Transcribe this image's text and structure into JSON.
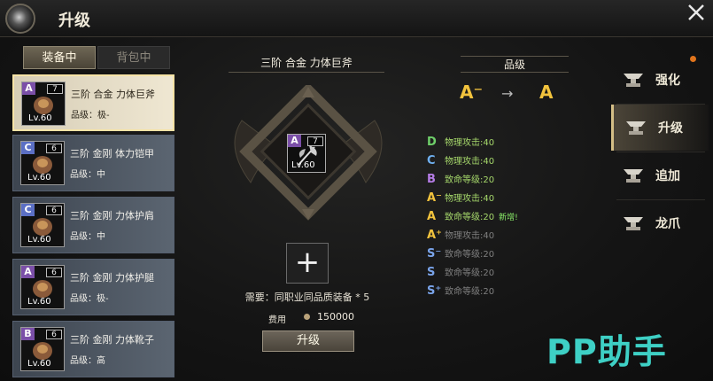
{
  "window": {
    "title": "升级"
  },
  "left_tabs": [
    {
      "label": "装备中",
      "active": true
    },
    {
      "label": "背包中",
      "active": false
    }
  ],
  "items": [
    {
      "grade": "A",
      "grade_suffix": "-",
      "grade_color": "#7b4fa8",
      "stars": "7",
      "level": "Lv.60",
      "name": "三阶 合金 力体巨斧",
      "quality": "品级：极-",
      "selected": true
    },
    {
      "grade": "C",
      "grade_suffix": "",
      "grade_color": "#5b6fc4",
      "stars": "6",
      "level": "Lv.60",
      "name": "三阶 金刚 体力铠甲",
      "quality": "品级：中",
      "selected": false
    },
    {
      "grade": "C",
      "grade_suffix": "",
      "grade_color": "#5b6fc4",
      "stars": "6",
      "level": "Lv.60",
      "name": "三阶 金刚 力体护肩",
      "quality": "品级：中",
      "selected": false
    },
    {
      "grade": "A",
      "grade_suffix": "",
      "grade_color": "#7b4fa8",
      "stars": "6",
      "level": "Lv.60",
      "name": "三阶 金刚 力体护腿",
      "quality": "品级：极-",
      "selected": false
    },
    {
      "grade": "B",
      "grade_suffix": "",
      "grade_color": "#7b4fa8",
      "stars": "6",
      "level": "Lv.60",
      "name": "三阶 金刚 力体靴子",
      "quality": "品级：高",
      "selected": false
    }
  ],
  "center": {
    "item_title": "三阶 合金 力体巨斧",
    "item_grade": "A",
    "item_stars": "7",
    "item_level": "Lv.60",
    "plus_symbol": "+",
    "requirement": "需要：同职业同品质装备 * 5",
    "cost_label": "费用",
    "cost_value": "150000",
    "upgrade_button": "升级"
  },
  "quality": {
    "header": "品级",
    "from": "A⁻",
    "arrow": "→",
    "to": "A"
  },
  "stats": [
    {
      "grade": "D",
      "color": "#6fd06a",
      "text": "物理攻击:40",
      "locked": false,
      "tag": ""
    },
    {
      "grade": "C",
      "color": "#6fb0f0",
      "text": "物理攻击:40",
      "locked": false,
      "tag": ""
    },
    {
      "grade": "B",
      "color": "#b57ce6",
      "text": "致命等级:20",
      "locked": false,
      "tag": ""
    },
    {
      "grade": "A⁻",
      "color": "#f2c33d",
      "text": "物理攻击:40",
      "locked": false,
      "tag": ""
    },
    {
      "grade": "A",
      "color": "#f2c33d",
      "text": "致命等级:20",
      "locked": false,
      "tag": "新增!"
    },
    {
      "grade": "A⁺",
      "color": "#f2c33d",
      "text": "物理攻击:40",
      "locked": true,
      "tag": ""
    },
    {
      "grade": "S⁻",
      "color": "#7aa4ea",
      "text": "致命等级:20",
      "locked": true,
      "tag": ""
    },
    {
      "grade": "S",
      "color": "#7aa4ea",
      "text": "致命等级:20",
      "locked": true,
      "tag": ""
    },
    {
      "grade": "S⁺",
      "color": "#7aa4ea",
      "text": "致命等级:20",
      "locked": true,
      "tag": ""
    }
  ],
  "nav": [
    {
      "label": "强化",
      "active": false,
      "icon": "anvil-icon"
    },
    {
      "label": "升级",
      "active": true,
      "icon": "anvil-icon"
    },
    {
      "label": "追加",
      "active": false,
      "icon": "anvil-icon"
    },
    {
      "label": "龙爪",
      "active": false,
      "icon": "anvil-icon"
    }
  ],
  "watermark": "PP助手"
}
